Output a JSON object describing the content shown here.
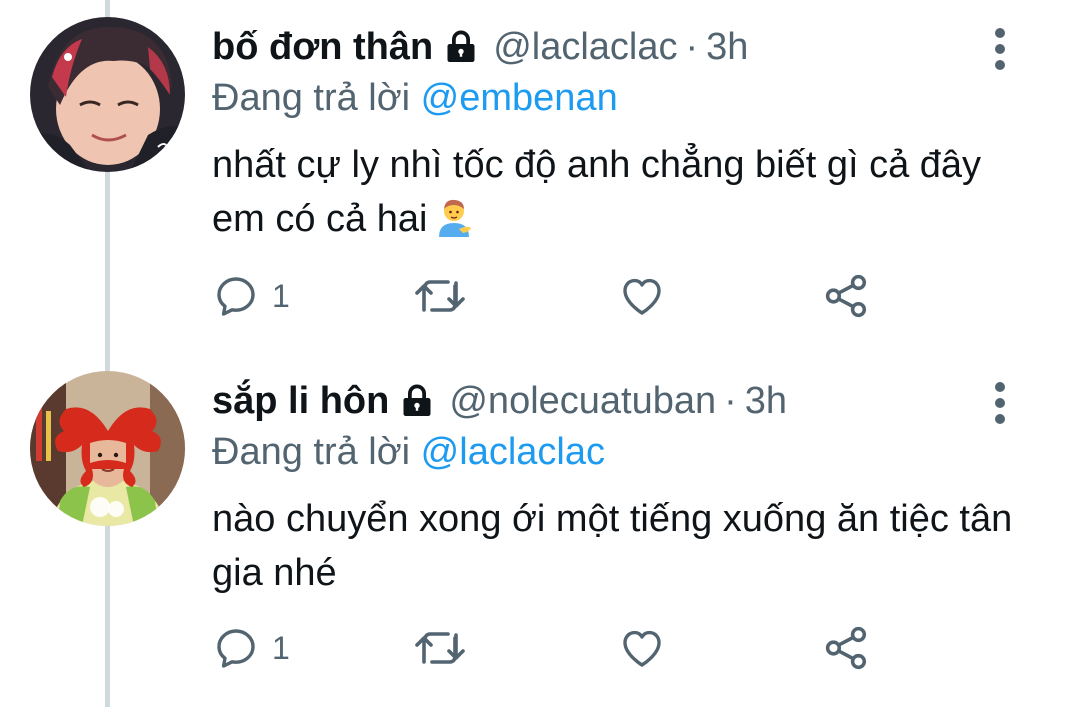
{
  "tweets": [
    {
      "display_name": "bố đơn thân",
      "handle": "@laclaclac",
      "separator": "·",
      "time": "3h",
      "replying_prefix": "Đang trả lời",
      "replying_to": "@embenan",
      "text": "nhất cự ly nhì tốc độ anh chẳng biết gì cả đây em có cả hai",
      "emoji": "man-tipping-hand-emoji",
      "reply_count": "1",
      "icons": {
        "lock": "lock-icon",
        "more": "more-vertical-icon",
        "reply": "reply-icon",
        "retweet": "retweet-icon",
        "like": "heart-icon",
        "share": "share-icon"
      }
    },
    {
      "display_name": "sắp li hôn",
      "handle": "@nolecuatuban",
      "separator": "·",
      "time": "3h",
      "replying_prefix": "Đang trả lời",
      "replying_to": "@laclaclac",
      "text": "nào chuyển xong ới một tiếng xuống ăn tiệc tân gia nhé",
      "reply_count": "1",
      "icons": {
        "lock": "lock-icon",
        "more": "more-vertical-icon",
        "reply": "reply-icon",
        "retweet": "retweet-icon",
        "like": "heart-icon",
        "share": "share-icon"
      }
    }
  ],
  "colors": {
    "text": "#0f1419",
    "secondary": "#536471",
    "mention": "#1d9bf0",
    "thread_line": "#cfd9de"
  }
}
